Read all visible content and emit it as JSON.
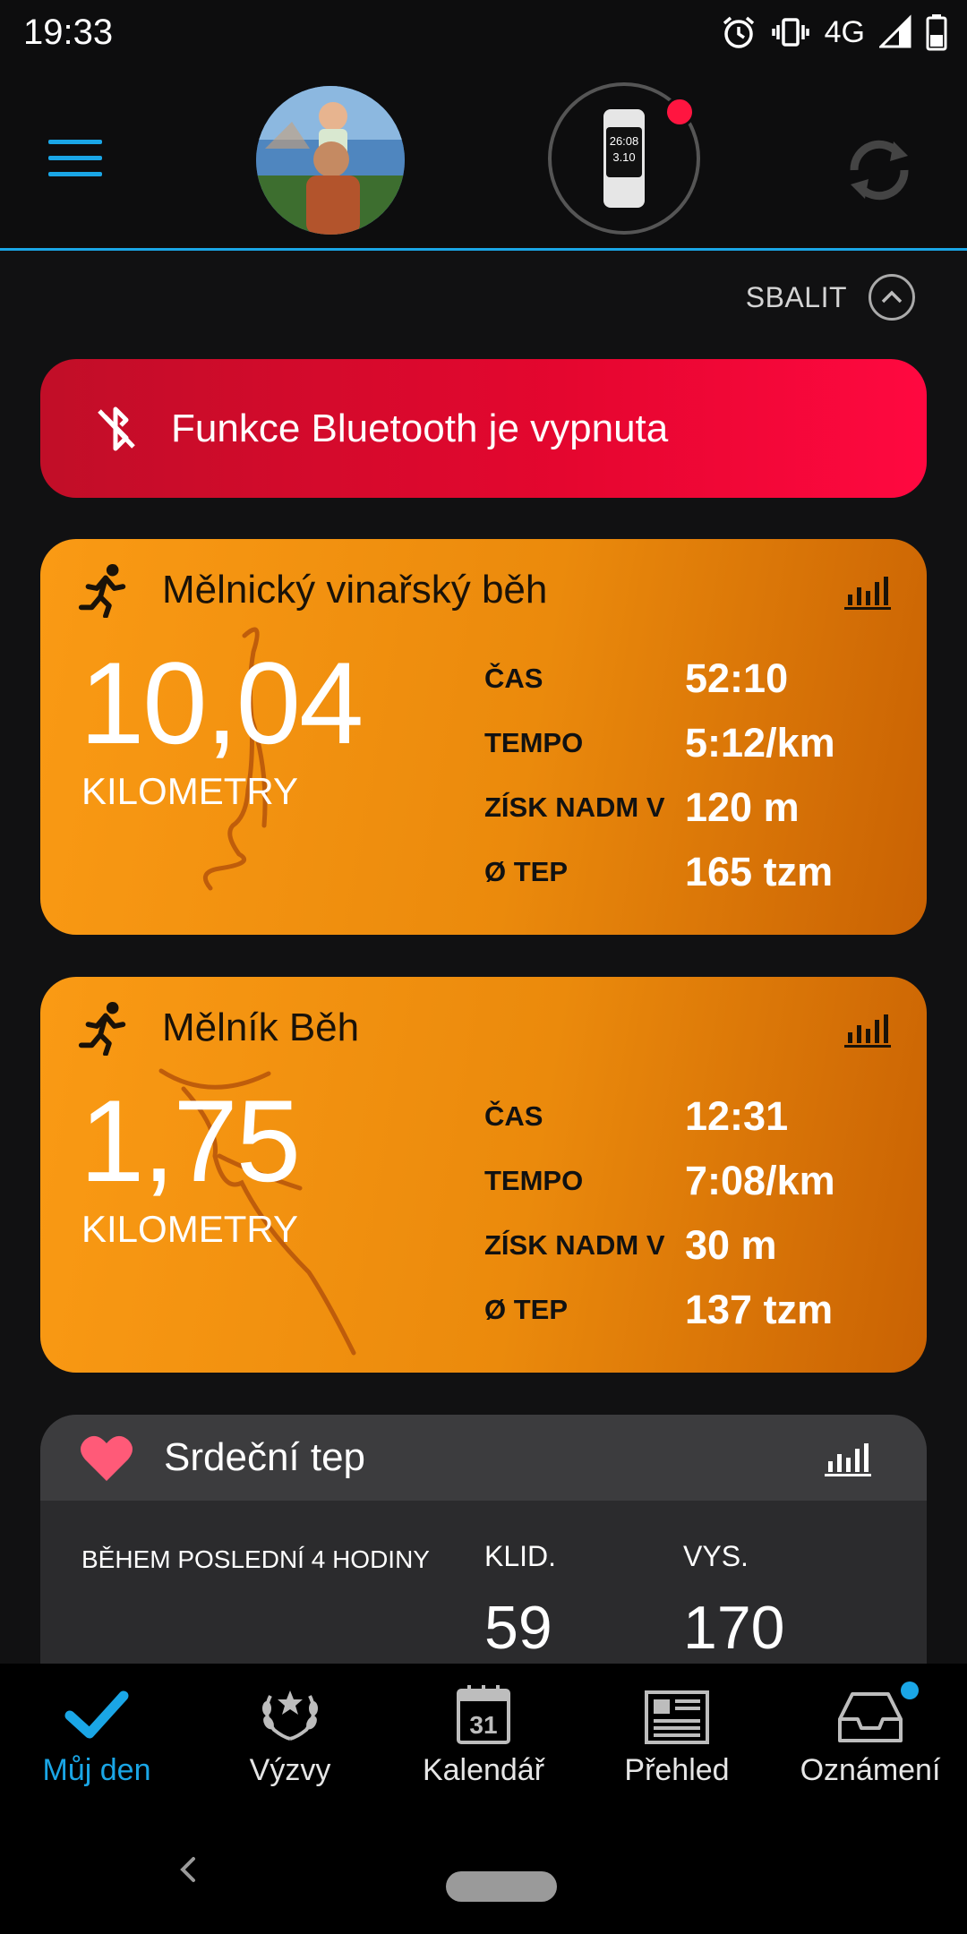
{
  "status_bar": {
    "time": "19:33",
    "network": "4G",
    "icons": [
      "alarm-icon",
      "vibrate-icon",
      "signal-icon",
      "battery-icon"
    ]
  },
  "header": {
    "menu_icon": "hamburger-icon",
    "device_screen": {
      "line1": "26:08",
      "line2": "3.10"
    },
    "sync_icon": "sync-icon",
    "accent_color": "#1aa6e6"
  },
  "collapse": {
    "label": "SBALIT"
  },
  "bluetooth_banner": {
    "text": "Funkce Bluetooth je vypnuta",
    "color": "#e5062f"
  },
  "activities": [
    {
      "title": "Mělnický vinařský běh",
      "distance": "10,04",
      "unit": "KILOMETRY",
      "stats": [
        {
          "label": "ČAS",
          "value": "52:10"
        },
        {
          "label": "TEMPO",
          "value": "5:12/km"
        },
        {
          "label": "ZÍSK NADM V",
          "value": "120 m"
        },
        {
          "label": "Ø TEP",
          "value": "165 tzm"
        }
      ]
    },
    {
      "title": "Mělník Běh",
      "distance": "1,75",
      "unit": "KILOMETRY",
      "stats": [
        {
          "label": "ČAS",
          "value": "12:31"
        },
        {
          "label": "TEMPO",
          "value": "7:08/km"
        },
        {
          "label": "ZÍSK NADM V",
          "value": "30 m"
        },
        {
          "label": "Ø TEP",
          "value": "137 tzm"
        }
      ]
    }
  ],
  "heart_rate": {
    "title": "Srdeční tep",
    "period": "BĚHEM POSLEDNÍ 4 HODINY",
    "resting_label": "KLID.",
    "resting_value": "59",
    "high_label": "VYS.",
    "high_value": "170"
  },
  "bottom_nav": [
    {
      "label": "Můj den",
      "icon": "checkmark-icon",
      "active": true
    },
    {
      "label": "Výzvy",
      "icon": "laurel-icon",
      "active": false
    },
    {
      "label": "Kalendář",
      "icon": "calendar-icon",
      "calendar_day": "31",
      "active": false
    },
    {
      "label": "Přehled",
      "icon": "news-icon",
      "active": false
    },
    {
      "label": "Oznámení",
      "icon": "inbox-icon",
      "active": false
    }
  ]
}
